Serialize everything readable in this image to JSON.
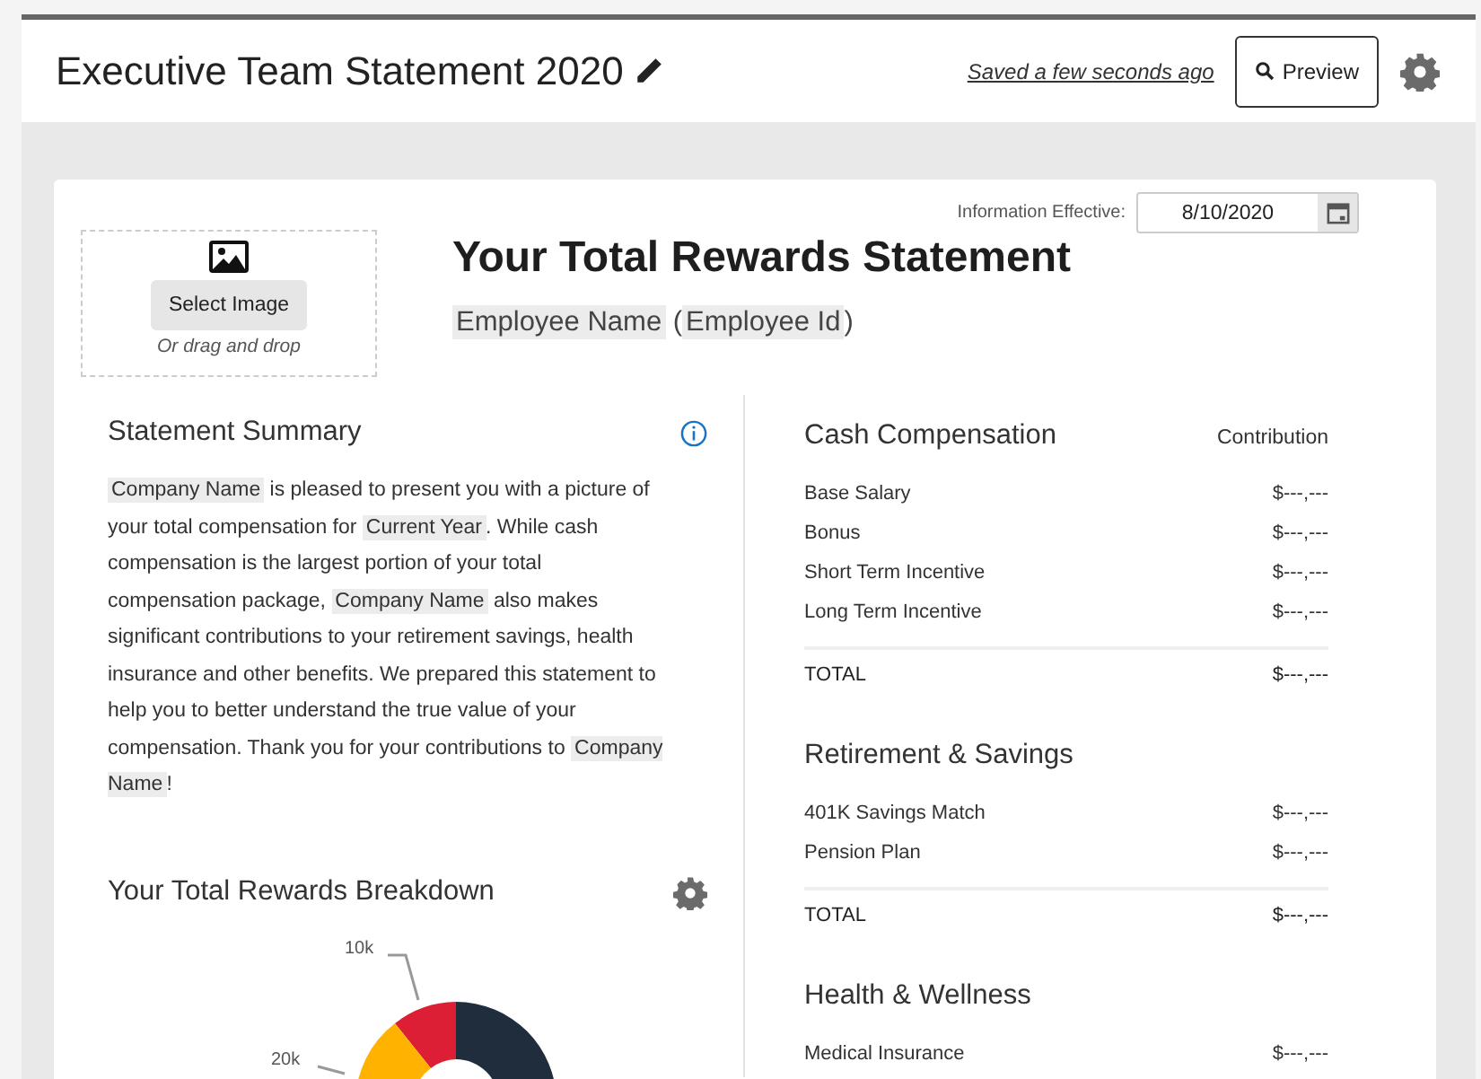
{
  "header": {
    "title": "Executive Team Statement 2020",
    "save_status": "Saved a few seconds ago",
    "preview_button": "Preview"
  },
  "statement": {
    "effective_label": "Information Effective:",
    "effective_date": "8/10/2020",
    "select_image_button": "Select Image",
    "drag_hint": "Or drag and drop",
    "title": "Your Total Rewards Statement",
    "employee_line": [
      {
        "kind": "field",
        "text": "Employee Name"
      },
      {
        "kind": "text",
        "text": " ("
      },
      {
        "kind": "field",
        "text": "Employee Id"
      },
      {
        "kind": "text",
        "text": ")"
      }
    ]
  },
  "summary": {
    "title": "Statement Summary",
    "segments": [
      {
        "kind": "field",
        "text": "Company Name"
      },
      {
        "kind": "text",
        "text": " is pleased to present you with a picture of your total compensation for "
      },
      {
        "kind": "field",
        "text": "Current Year"
      },
      {
        "kind": "text",
        "text": ". While cash compensation is the largest portion of your total compensation package, "
      },
      {
        "kind": "field",
        "text": "Company Name"
      },
      {
        "kind": "text",
        "text": " also makes significant contributions to your retirement savings, health insurance and other benefits. We prepared this statement to help you to better understand the true value of your compensation. Thank you for your contributions to "
      },
      {
        "kind": "field",
        "text": "Company Name"
      },
      {
        "kind": "text",
        "text": "!"
      }
    ]
  },
  "breakdown": {
    "title": "Your Total Rewards Breakdown",
    "slice_labels": [
      "10k",
      "20k"
    ]
  },
  "sections": [
    {
      "title": "Cash Compensation",
      "column_header": "Contribution",
      "rows": [
        {
          "label": "Base Salary",
          "value": "$---,---"
        },
        {
          "label": "Bonus",
          "value": "$---,---"
        },
        {
          "label": "Short Term Incentive",
          "value": "$---,---"
        },
        {
          "label": "Long Term Incentive",
          "value": "$---,---"
        }
      ],
      "total": {
        "label": "TOTAL",
        "value": "$---,---"
      }
    },
    {
      "title": "Retirement & Savings",
      "rows": [
        {
          "label": "401K Savings Match",
          "value": "$---,---"
        },
        {
          "label": "Pension Plan",
          "value": "$---,---"
        }
      ],
      "total": {
        "label": "TOTAL",
        "value": "$---,---"
      }
    },
    {
      "title": "Health & Wellness",
      "rows": [
        {
          "label": "Medical Insurance",
          "value": "$---,---"
        }
      ]
    }
  ]
}
